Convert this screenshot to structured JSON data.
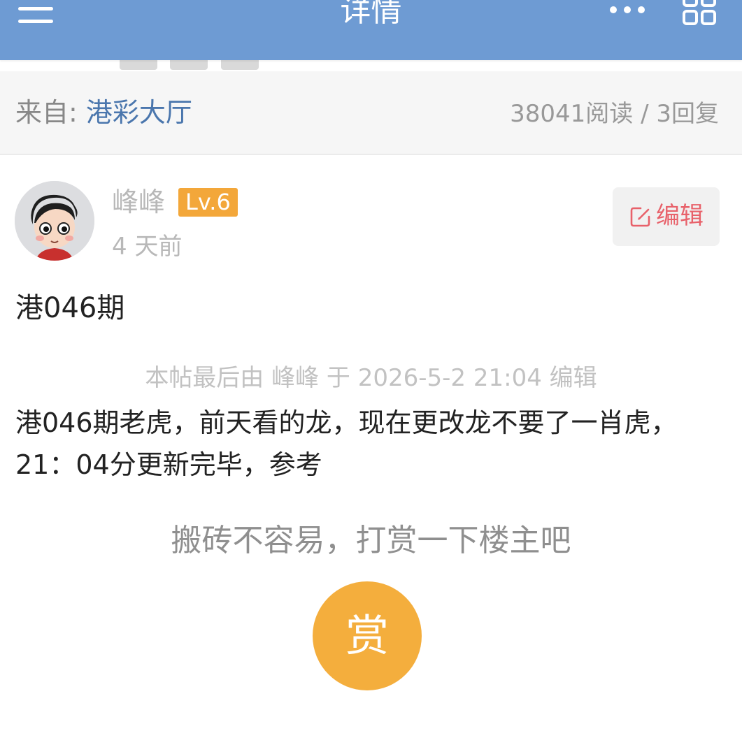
{
  "header": {
    "title": "详情",
    "menu_icon": "hamburger-menu-icon",
    "more_icon": "more-dots-icon",
    "grid_icon": "grid-apps-icon",
    "background_color": "#6e9bd3"
  },
  "source": {
    "label": "来自:",
    "forum_name": "港彩大厅",
    "stats": "38041阅读 / 3回复"
  },
  "post": {
    "author_name": "峰峰",
    "level": "Lv.6",
    "time": "4 天前",
    "edit_label": "编辑",
    "title": "港046期",
    "edit_note": "本帖最后由 峰峰 于 2026-5-2 21:04 编辑",
    "body": "港046期老虎，前天看的龙，现在更改龙不要了一肖虎，21：04分更新完毕，参考"
  },
  "reward": {
    "prompt": "搬砖不容易，打赏一下楼主吧",
    "button_label": "赏",
    "color": "#f4ae3d"
  },
  "colors": {
    "link": "#4a76ad",
    "level_badge": "#f3a73a",
    "edit": "#e8616a"
  }
}
